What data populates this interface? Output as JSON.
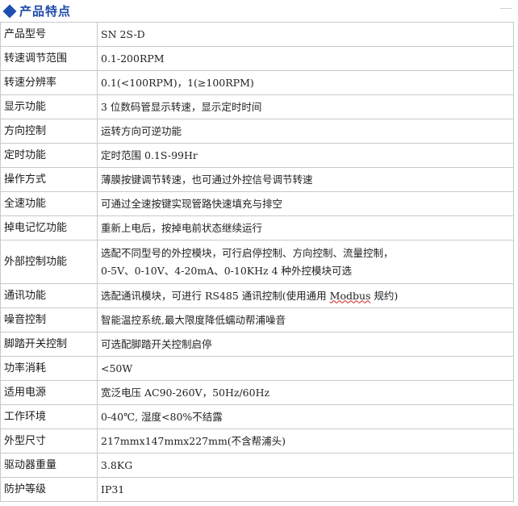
{
  "header": {
    "title": "产品特点",
    "icon": "diamond-icon",
    "accent": "#1d4aa8"
  },
  "specs": [
    {
      "label": "产品型号",
      "value": "SN 2S-D"
    },
    {
      "label": "转速调节范围",
      "value": "0.1-200RPM"
    },
    {
      "label": "转速分辨率",
      "value": "0.1(<100RPM)，1(≥100RPM)"
    },
    {
      "label": "显示功能",
      "value": "3 位数码管显示转速，显示定时时间"
    },
    {
      "label": "方向控制",
      "value": "运转方向可逆功能"
    },
    {
      "label": "定时功能",
      "value": "定时范围 0.1S-99Hr"
    },
    {
      "label": "操作方式",
      "value": "薄膜按键调节转速，也可通过外控信号调节转速"
    },
    {
      "label": "全速功能",
      "value": "可通过全速按键实现管路快速填充与排空"
    },
    {
      "label": "掉电记忆功能",
      "value": "重新上电后，按掉电前状态继续运行"
    },
    {
      "label": "外部控制功能",
      "value": "选配不同型号的外控模块，可行启停控制、方向控制、流量控制，",
      "value2": "0-5V、0-10V、4-20mA、0-10KHz 4 种外控模块可选"
    },
    {
      "label": "通讯功能",
      "value": "选配通讯模块，可进行 RS485 通讯控制(使用通用 ",
      "value_marked": "Modbus",
      "value_tail": " 规约)"
    },
    {
      "label": "噪音控制",
      "value": "智能温控系统,最大限度降低蠕动帮浦噪音"
    },
    {
      "label": "脚踏开关控制",
      "value": "可选配脚踏开关控制启停"
    },
    {
      "label": "功率消耗",
      "value": "<50W"
    },
    {
      "label": "适用电源",
      "value": "宽泛电压 AC90-260V，50Hz/60Hz"
    },
    {
      "label": "工作环境",
      "value": "0-40℃, 湿度<80%不结露"
    },
    {
      "label": "外型尺寸",
      "value": "217mmx147mmx227mm(不含帮浦头)"
    },
    {
      "label": "驱动器重量",
      "value": "3.8KG"
    },
    {
      "label": "防护等级",
      "value": "IP31"
    }
  ]
}
